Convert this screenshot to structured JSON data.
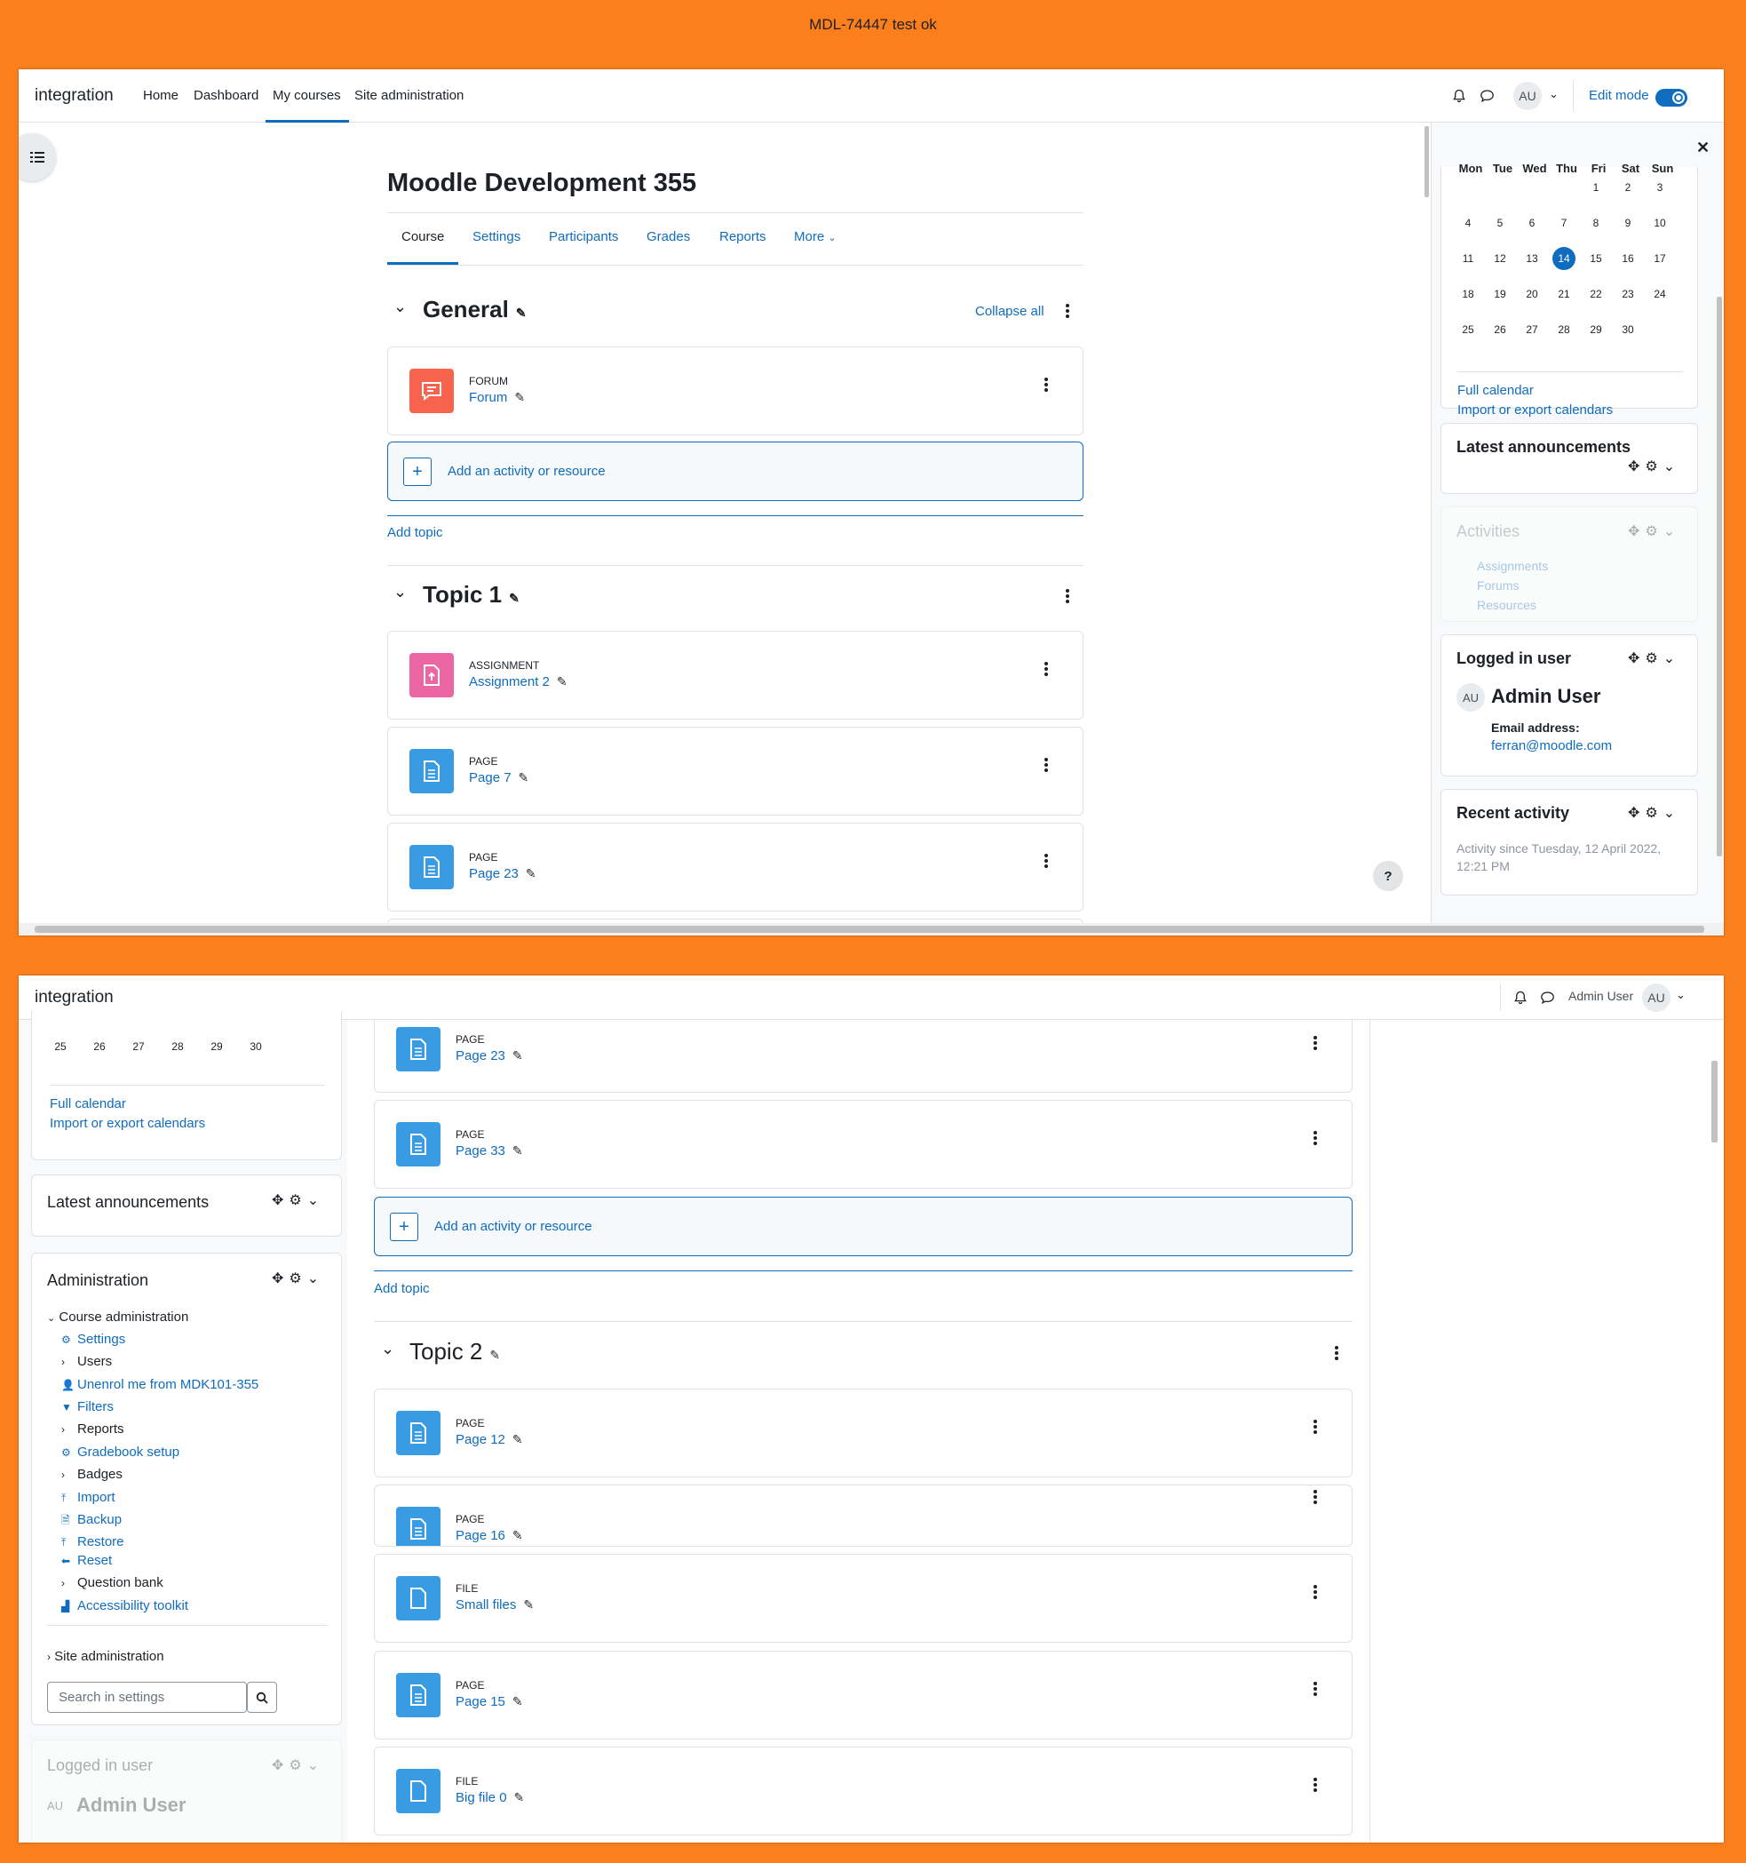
{
  "banner": "MDL-74447 test ok",
  "top": {
    "brand": "integration",
    "nav": [
      "Home",
      "Dashboard",
      "My courses",
      "Site administration"
    ],
    "user_initials": "AU",
    "edit_mode_label": "Edit mode",
    "course_title": "Moodle Development 355",
    "tabs": [
      "Course",
      "Settings",
      "Participants",
      "Grades",
      "Reports",
      "More"
    ],
    "general": {
      "title": "General",
      "collapse_all": "Collapse all",
      "activity": {
        "type": "FORUM",
        "name": "Forum"
      }
    },
    "add_activity": "Add an activity or resource",
    "add_topic": "Add topic",
    "topic1": {
      "title": "Topic 1",
      "activities": [
        {
          "type": "ASSIGNMENT",
          "name": "Assignment 2"
        },
        {
          "type": "PAGE",
          "name": "Page 7"
        },
        {
          "type": "PAGE",
          "name": "Page 23"
        }
      ]
    },
    "calendar": {
      "days": [
        "Mon",
        "Tue",
        "Wed",
        "Thu",
        "Fri",
        "Sat",
        "Sun"
      ],
      "today": "14",
      "full_calendar": "Full calendar",
      "import_export": "Import or export calendars"
    },
    "latest_announcements": "Latest announcements",
    "activities_block": {
      "title": "Activities",
      "items": [
        "Assignments",
        "Forums",
        "Resources"
      ]
    },
    "logged_in": {
      "title": "Logged in user",
      "name": "Admin User",
      "email_label": "Email address:",
      "email": "ferran@moodle.com"
    },
    "recent_activity": {
      "title": "Recent activity",
      "since": "Activity since Tuesday, 12 April 2022, 12:21 PM"
    },
    "help": "?"
  },
  "bottom": {
    "brand": "integration",
    "user_name": "Admin User",
    "user_initials": "AU",
    "calendar_row": [
      "25",
      "26",
      "27",
      "28",
      "29",
      "30"
    ],
    "full_calendar": "Full calendar",
    "import_export": "Import or export calendars",
    "latest_announcements": "Latest announcements",
    "administration": {
      "title": "Administration",
      "course_admin": "Course administration",
      "items": [
        "Settings",
        "Users",
        "Unenrol me from MDK101-355",
        "Filters",
        "Reports",
        "Gradebook setup",
        "Badges",
        "Import",
        "Backup",
        "Restore",
        "Reset",
        "Question bank",
        "Accessibility toolkit"
      ],
      "site_admin": "Site administration",
      "search_placeholder": "Search in settings"
    },
    "logged_in": {
      "title": "Logged in user",
      "name": "Admin User"
    },
    "activities_top": [
      {
        "type": "PAGE",
        "name": "Page 23"
      },
      {
        "type": "PAGE",
        "name": "Page 33"
      }
    ],
    "add_activity": "Add an activity or resource",
    "add_topic": "Add topic",
    "topic2": {
      "title": "Topic 2",
      "activities": [
        {
          "type": "PAGE",
          "name": "Page 12"
        },
        {
          "type": "PAGE",
          "name": "Page 16"
        },
        {
          "type": "FILE",
          "name": "Small files"
        },
        {
          "type": "PAGE",
          "name": "Page 15"
        },
        {
          "type": "FILE",
          "name": "Big file 0"
        }
      ]
    }
  },
  "colors": {
    "background": "#fb7f1c",
    "link": "#0f6cbf",
    "forum": "#f7634d",
    "assignment": "#eb66a2",
    "page": "#399be2"
  }
}
